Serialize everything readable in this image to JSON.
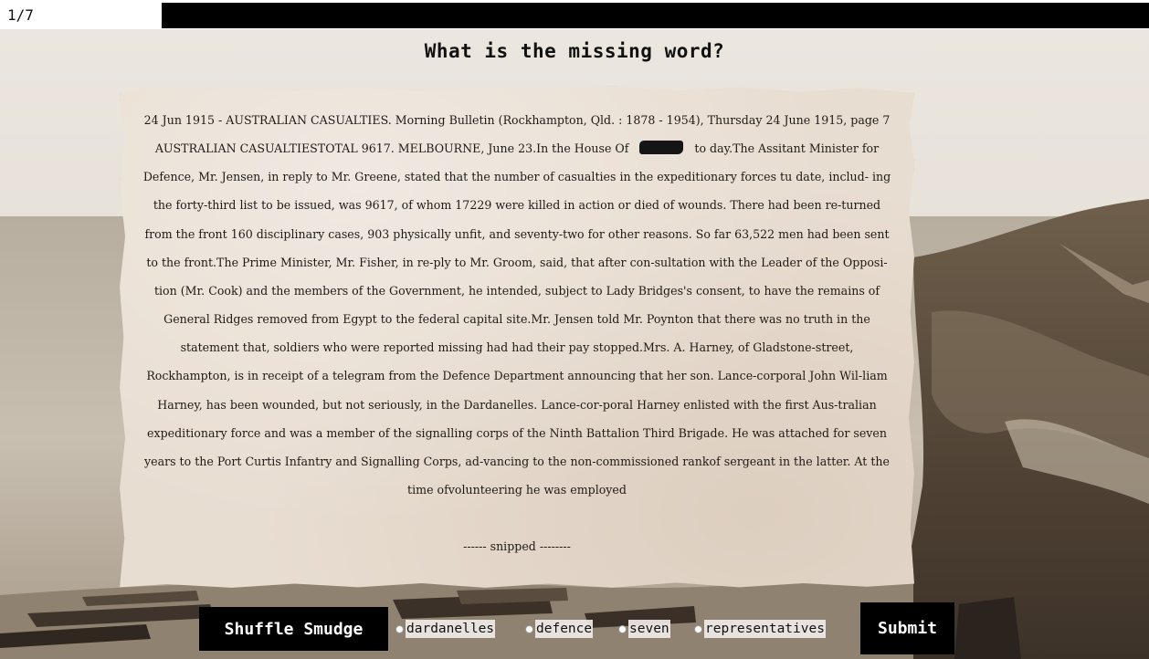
{
  "progress": {
    "counter": "1/7",
    "current": 1,
    "total": 7
  },
  "question": {
    "title": "What is the missing word?"
  },
  "article": {
    "text_before": "24 Jun 1915 - AUSTRALIAN CASUALTIES. Morning Bulletin (Rockhampton, Qld. : 1878 - 1954), Thursday 24 June 1915, page 7 AUSTRALIAN CASUALTIESTOTAL 9617. MELBOURNE, June 23.In the House Of",
    "text_after": "to day.The Assitant Minister for Defence, Mr. Jensen, in reply to Mr. Greene, stated that the number of casualties in the expeditionary forces tu date, includ- ing the forty-third list to be issued, was 9617, of whom 17229 were killed in action or died of wounds. There had been re-turned from the front 160 disciplinary cases, 903 physically unfit, and seventy-two for other reasons. So far 63,522 men had been sent to the front.The Prime Minister, Mr. Fisher, in re-ply to Mr. Groom, said, that after con-sultation with the Leader of the Opposi-tion (Mr. Cook) and the members of the Government, he intended, subject to Lady Bridges's consent, to have the remains of General Ridges removed from Egypt to the federal capital site.Mr. Jensen told Mr. Poynton that there was no truth in the statement that, soldiers who were reported missing had had their pay stopped.Mrs. A. Harney, of Gladstone-street, Rockhampton, is in receipt of a telegram from the Defence Department announcing that her son. Lance-corporal John Wil-liam Harney, has been wounded, but not seriously, in the Dardanelles. Lance-cor-poral Harney enlisted with the first Aus-tralian expeditionary force and was a member of the signalling corps of the Ninth Battalion Third Brigade. He was attached for seven years to the Port Curtis Infantry and Signalling Corps, ad-vancing to the non-commissioned rankof sergeant in the latter. At the time ofvolunteering he was employed",
    "snipped": "------ snipped --------"
  },
  "controls": {
    "shuffle_label": "Shuffle Smudge",
    "submit_label": "Submit",
    "options": [
      {
        "label": "dardanelles",
        "selected": false
      },
      {
        "label": "defence",
        "selected": false
      },
      {
        "label": "seven",
        "selected": false
      },
      {
        "label": "representatives",
        "selected": false
      }
    ]
  },
  "colors": {
    "button_bg": "#000000",
    "button_text": "#ffffff",
    "paper": "#e8ddd1",
    "redaction": "#151515"
  }
}
